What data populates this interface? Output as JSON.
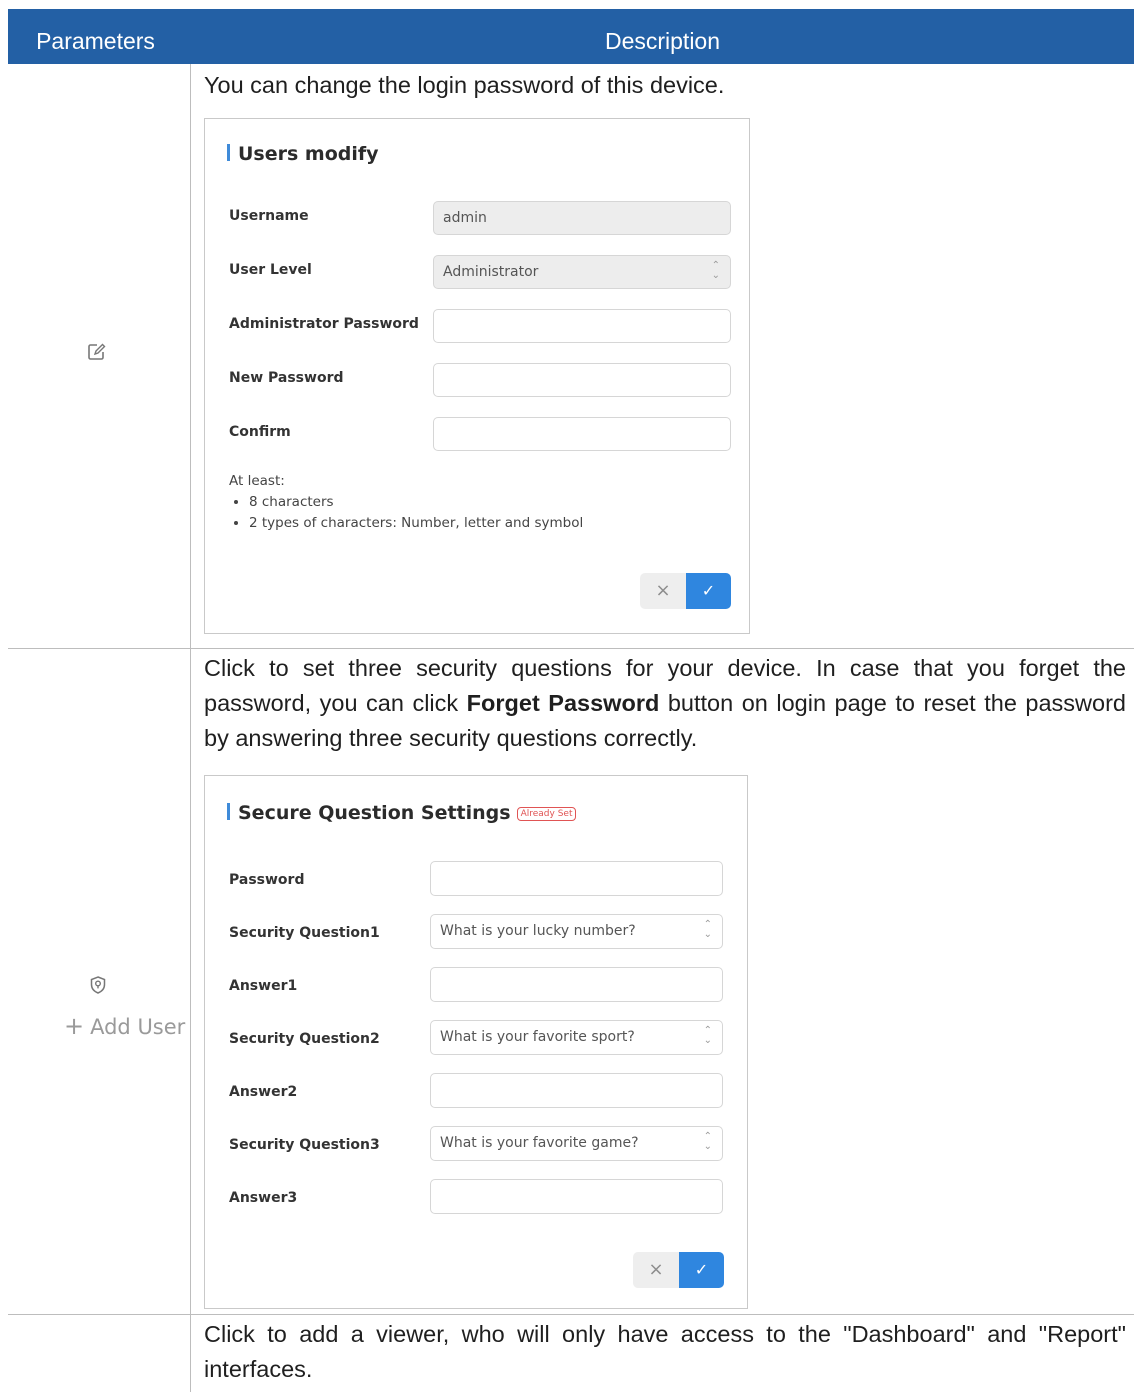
{
  "header": {
    "col1": "Parameters",
    "col2": "Description"
  },
  "rows": [
    {
      "icon": "edit-icon",
      "text": "You can change the login password of this device."
    },
    {
      "icon": "shield-icon",
      "text_before": "Click to set three security questions for your device. In case that you forget the password, you can click ",
      "bold": "Forget Password",
      "text_after": " button on login page to reset the password by answering three security questions correctly."
    },
    {
      "label": "Add User",
      "text": "Click to add a viewer, who will only have access to the \"Dashboard\" and \"Report\" interfaces."
    }
  ],
  "users_modify": {
    "title": "Users modify",
    "username_label": "Username",
    "username_value": "admin",
    "level_label": "User Level",
    "level_value": "Administrator",
    "admin_pw_label": "Administrator Password",
    "new_pw_label": "New Password",
    "confirm_label": "Confirm",
    "note_title": "At least:",
    "note_items": [
      "8 characters",
      "2 types of characters: Number, letter and symbol"
    ],
    "cancel": "×",
    "ok": "✓"
  },
  "secure_questions": {
    "title": "Secure Question Settings",
    "badge": "Already Set",
    "password_label": "Password",
    "q1_label": "Security Question1",
    "q1_value": "What is your lucky number?",
    "a1_label": "Answer1",
    "q2_label": "Security Question2",
    "q2_value": "What is your favorite sport?",
    "a2_label": "Answer2",
    "q3_label": "Security Question3",
    "q3_value": "What is your favorite game?",
    "a3_label": "Answer3",
    "cancel": "×",
    "ok": "✓"
  },
  "colors": {
    "header_bg": "#2360a5",
    "accent": "#2f86df",
    "badge": "#e05454"
  }
}
